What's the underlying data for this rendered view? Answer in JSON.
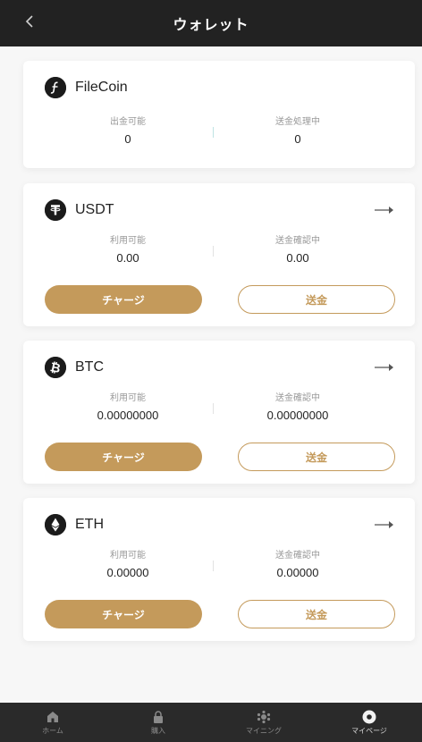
{
  "header": {
    "title": "ウォレット"
  },
  "cards": [
    {
      "coin": "FileCoin",
      "left_label": "出金可能",
      "left_value": "0",
      "right_label": "送金処理中",
      "right_value": "0"
    },
    {
      "coin": "USDT",
      "left_label": "利用可能",
      "left_value": "0.00",
      "right_label": "送金確認中",
      "right_value": "0.00",
      "charge": "チャージ",
      "send": "送金"
    },
    {
      "coin": "BTC",
      "left_label": "利用可能",
      "left_value": "0.00000000",
      "right_label": "送金確認中",
      "right_value": "0.00000000",
      "charge": "チャージ",
      "send": "送金"
    },
    {
      "coin": "ETH",
      "left_label": "利用可能",
      "left_value": "0.00000",
      "right_label": "送金確認中",
      "right_value": "0.00000",
      "charge": "チャージ",
      "send": "送金"
    }
  ],
  "tabbar": [
    {
      "label": "ホーム",
      "icon": "home-icon"
    },
    {
      "label": "購入",
      "icon": "lock-icon"
    },
    {
      "label": "マイニング",
      "icon": "mining-icon"
    },
    {
      "label": "マイページ",
      "icon": "profile-icon"
    }
  ],
  "colors": {
    "accent": "#c49a5b",
    "header_bg": "#222222",
    "tabbar_bg": "#2a2a2a"
  }
}
